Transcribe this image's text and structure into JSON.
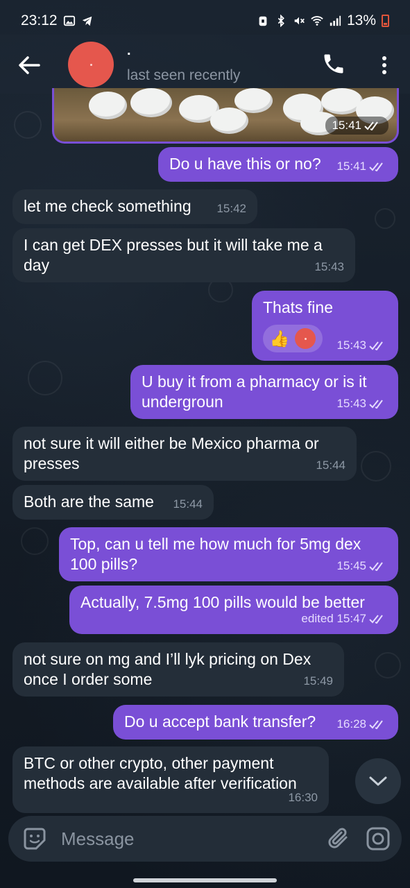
{
  "status_bar": {
    "time": "23:12",
    "battery": "13%"
  },
  "header": {
    "name": ".",
    "status": "last seen recently"
  },
  "photo": {
    "time": "15:41"
  },
  "messages": [
    {
      "dir": "out",
      "text": "Do u have this or no?",
      "time": "15:41"
    },
    {
      "dir": "in",
      "text": "let me check something",
      "time": "15:42"
    },
    {
      "dir": "in",
      "text": "I can get DEX presses but it will take me a day",
      "time": "15:43"
    },
    {
      "dir": "out",
      "text": "Thats fine",
      "time": "15:43",
      "reaction": "👍"
    },
    {
      "dir": "out",
      "text": "U buy it from a pharmacy or is it undergroun",
      "time": "15:43"
    },
    {
      "dir": "in",
      "text": "not sure it will either be Mexico pharma or presses",
      "time": "15:44"
    },
    {
      "dir": "in",
      "text": "Both are the same",
      "time": "15:44"
    },
    {
      "dir": "out",
      "text": "Top, can u tell me how much for 5mg dex 100 pills?",
      "time": "15:45"
    },
    {
      "dir": "out",
      "text": "Actually, 7.5mg 100 pills would be better",
      "time": "edited 15:47"
    },
    {
      "dir": "in",
      "text": "not sure on mg and I’ll lyk pricing on Dex once I order some",
      "time": "15:49"
    },
    {
      "dir": "out",
      "text": "Do u accept bank transfer?",
      "time": "16:28"
    },
    {
      "dir": "in",
      "text": "BTC or other crypto, other payment methods are available after verification",
      "time": "16:30"
    }
  ],
  "input": {
    "placeholder": "Message"
  },
  "colors": {
    "outgoing": "#7a4fd6",
    "incoming": "#242e39",
    "avatar": "#e5574d"
  }
}
